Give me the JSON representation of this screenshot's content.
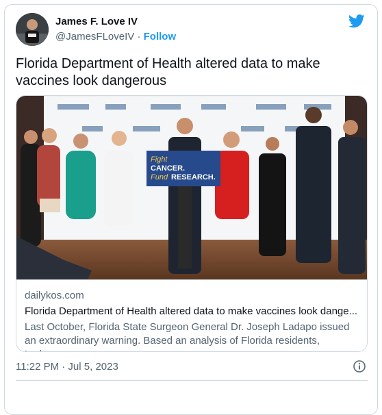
{
  "author": {
    "name": "James F. Love IV",
    "handle": "@JamesFLoveIV",
    "separator": "·",
    "follow_label": "Follow",
    "avatar_icon": "user-avatar-icon"
  },
  "brand_icon": "twitter-bird-icon",
  "brand_color": "#1d9bf0",
  "tweet": {
    "text": "Florida Department of Health altered data to make vaccines look dangerous"
  },
  "card": {
    "image_sign_text": "Fight CANCER. Fund RESEARCH.",
    "domain": "dailykos.com",
    "title": "Florida Department of Health altered data to make vaccines look dange...",
    "description": "Last October, Florida State Surgeon General Dr. Joseph Ladapo issued an extraordinary warning. Based an analysis of Florida residents, Ladapo ..."
  },
  "meta": {
    "timestamp": "11:22 PM · Jul 5, 2023",
    "info_icon": "info-icon"
  }
}
